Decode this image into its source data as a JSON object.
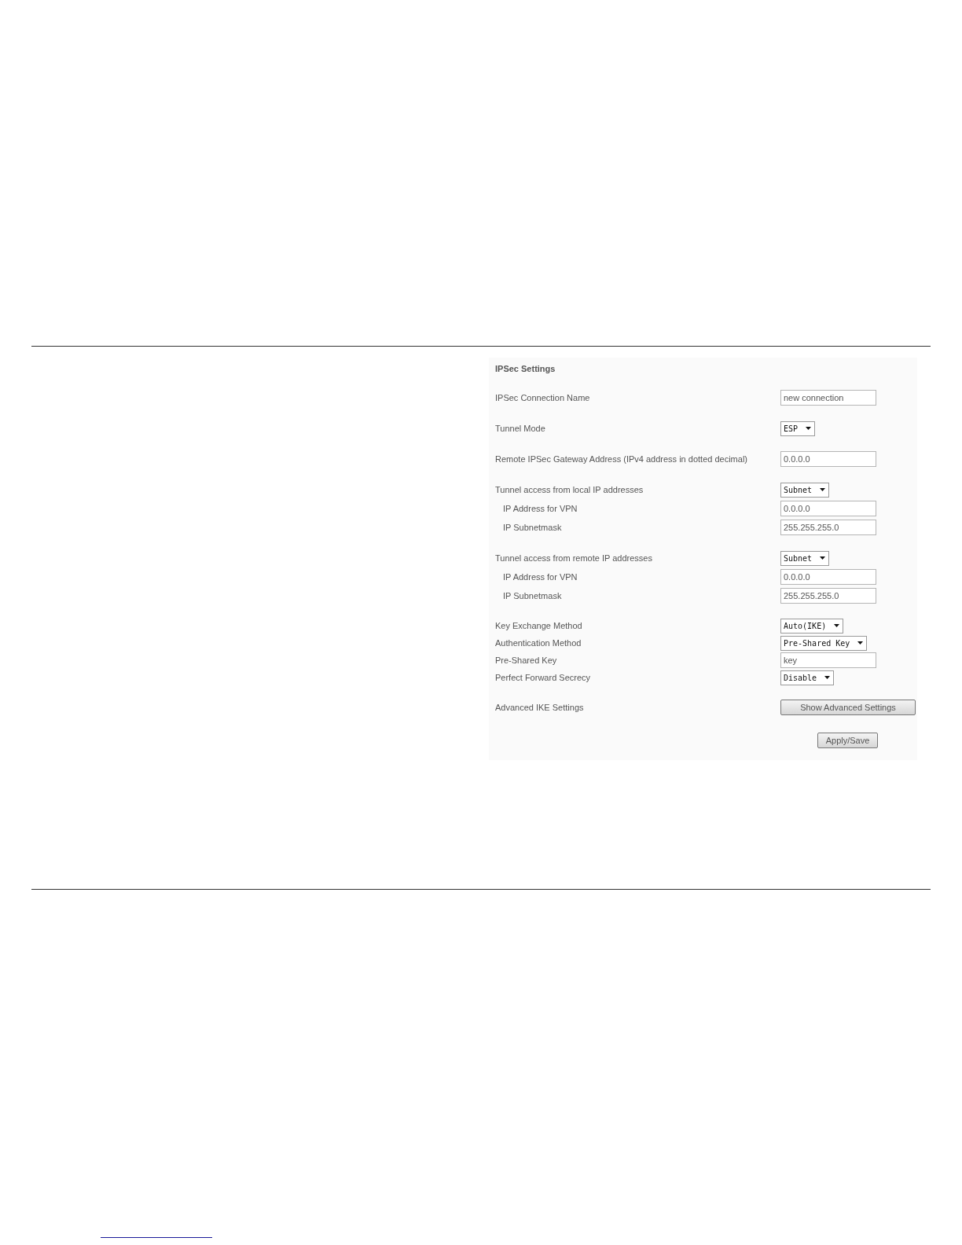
{
  "panel": {
    "title": "IPSec Settings",
    "groups": [
      {
        "rows": [
          {
            "label": "IPSec Connection Name",
            "kind": "input",
            "value": "new connection",
            "indented": false
          }
        ]
      },
      {
        "rows": [
          {
            "label": "Tunnel Mode",
            "kind": "select",
            "value": "ESP",
            "indented": false
          }
        ]
      },
      {
        "rows": [
          {
            "label": "Remote IPSec Gateway Address (IPv4 address in dotted decimal)",
            "kind": "input",
            "value": "0.0.0.0",
            "indented": false
          }
        ]
      },
      {
        "rows": [
          {
            "label": "Tunnel access from local IP addresses",
            "kind": "select",
            "value": "Subnet",
            "indented": false
          },
          {
            "label": "IP Address for VPN",
            "kind": "input",
            "value": "0.0.0.0",
            "indented": true
          },
          {
            "label": "IP Subnetmask",
            "kind": "input",
            "value": "255.255.255.0",
            "indented": true
          }
        ]
      },
      {
        "rows": [
          {
            "label": "Tunnel access from remote IP addresses",
            "kind": "select",
            "value": "Subnet",
            "indented": false
          },
          {
            "label": "IP Address for VPN",
            "kind": "input",
            "value": "0.0.0.0",
            "indented": true
          },
          {
            "label": "IP Subnetmask",
            "kind": "input",
            "value": "255.255.255.0",
            "indented": true
          }
        ]
      },
      {
        "rows": [
          {
            "label": "Key Exchange Method",
            "kind": "select",
            "value": "Auto(IKE)",
            "indented": false
          },
          {
            "label": "Authentication Method",
            "kind": "select",
            "value": "Pre-Shared Key",
            "indented": false
          },
          {
            "label": "Pre-Shared Key",
            "kind": "input",
            "value": "key",
            "indented": false
          },
          {
            "label": "Perfect Forward Secrecy",
            "kind": "select",
            "value": "Disable",
            "indented": false
          }
        ]
      },
      {
        "rows": [
          {
            "label": "Advanced IKE Settings",
            "kind": "button",
            "value": "Show Advanced Settings",
            "indented": false
          }
        ]
      }
    ],
    "apply_button": "Apply/Save"
  }
}
